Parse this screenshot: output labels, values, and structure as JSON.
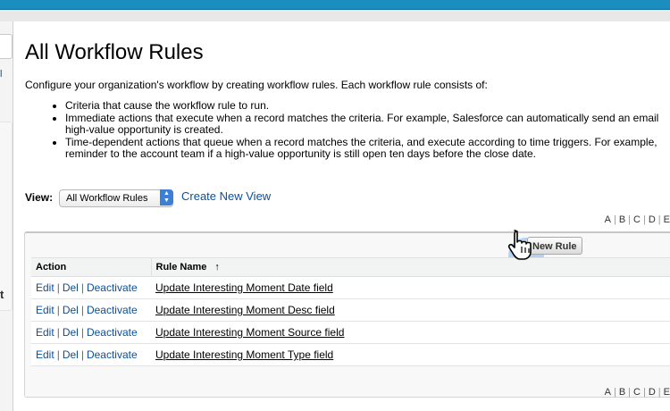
{
  "page": {
    "title": "All Workflow Rules",
    "intro": "Configure your organization's workflow by creating workflow rules. Each workflow rule consists of:",
    "bullets": [
      {
        "lines": [
          "Criteria that cause the workflow rule to run."
        ]
      },
      {
        "lines": [
          "Immediate actions that execute when a record matches the criteria. For example, Salesforce can automatically send an email",
          "high-value opportunity is created."
        ]
      },
      {
        "lines": [
          "Time-dependent actions that queue when a record matches the criteria, and execute according to time triggers. For example,",
          "reminder to the account team if a high-value opportunity is still open ten days before the close date."
        ]
      }
    ]
  },
  "sidebar": {
    "link_fragment": "l",
    "label_fragment": "t"
  },
  "view": {
    "label": "View:",
    "selected": "All Workflow Rules",
    "create_link": "Create New View"
  },
  "alpha_index": [
    "A",
    "B",
    "C",
    "D",
    "E"
  ],
  "toolbar": {
    "new_rule_label": "New Rule"
  },
  "table": {
    "headers": [
      "Action",
      "Rule Name",
      "↑"
    ],
    "action_labels": {
      "edit": "Edit",
      "del": "Del",
      "deactivate": "Deactivate"
    },
    "separator": "|",
    "rows": [
      {
        "rule_name": "Update Interesting Moment Date field"
      },
      {
        "rule_name": "Update Interesting Moment Desc field"
      },
      {
        "rule_name": "Update Interesting Moment Source field"
      },
      {
        "rule_name": "Update Interesting Moment Type field"
      }
    ]
  },
  "colors": {
    "header_blue": "#1b8dbf",
    "link_blue": "#0b4f9c",
    "select_accent": "#3c7fd6"
  }
}
